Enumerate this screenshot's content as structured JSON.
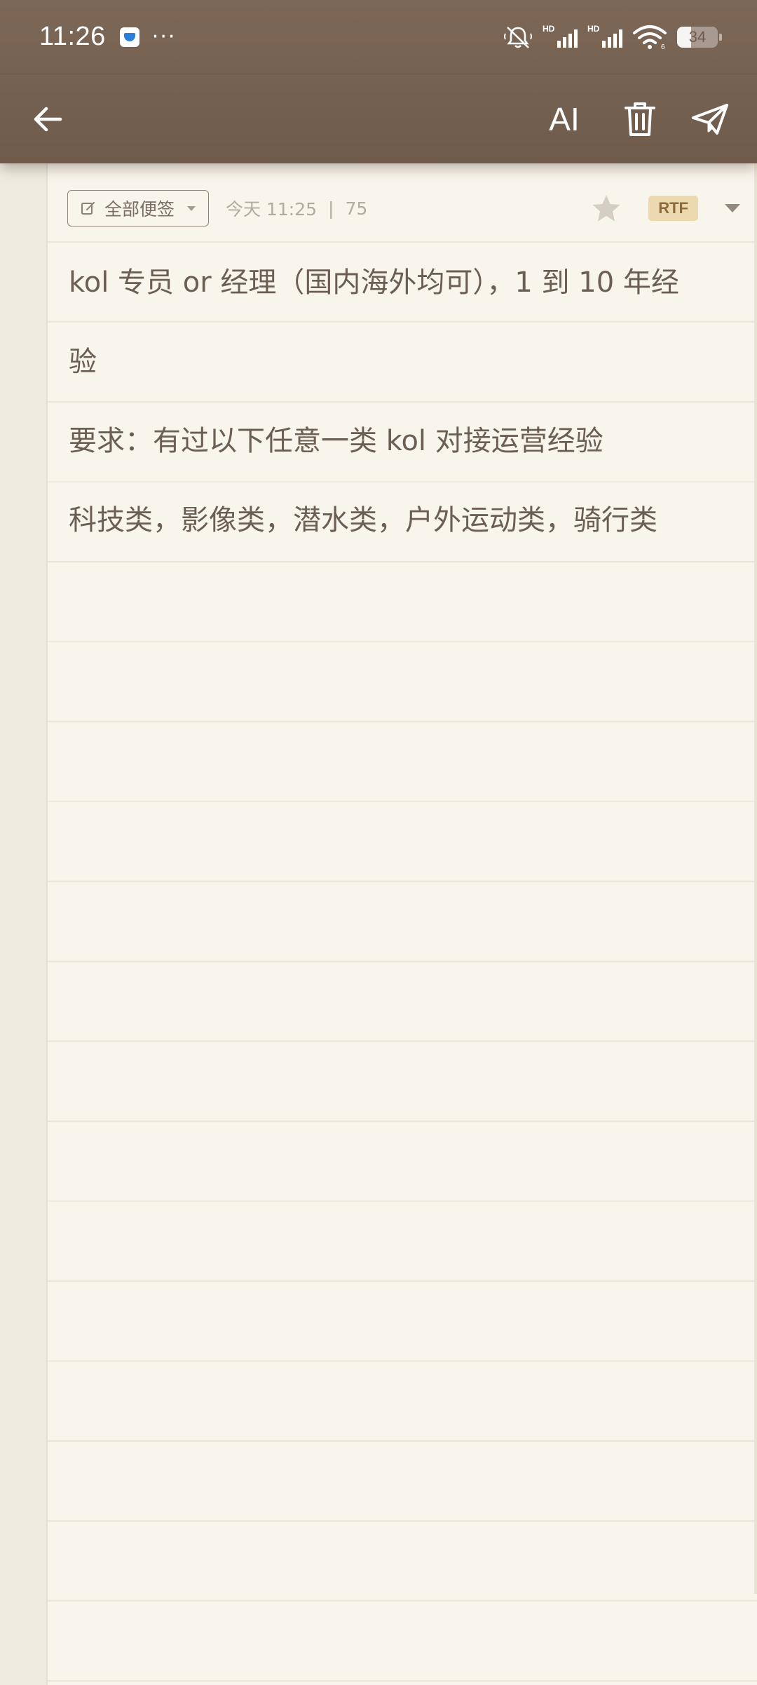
{
  "status_bar": {
    "time": "11:26",
    "dots": "···",
    "battery_level": "34",
    "hd_label": "HD"
  },
  "toolbar": {
    "ai_label": "AI"
  },
  "note_meta": {
    "folder_label": "全部便签",
    "date": "今天 11:25",
    "separator": "|",
    "char_count": "75",
    "format_badge": "RTF"
  },
  "note_lines": [
    "kol 专员 or 经理（国内海外均可），1 到 10 年经",
    "验",
    "要求：有过以下任意一类 kol 对接运营经验",
    "科技类，影像类，潜水类，户外运动类，骑行类"
  ],
  "colors": {
    "header_brown": "#75614f",
    "paper": "#f8f5ec",
    "text": "#6b5e52",
    "rtf_badge_bg": "#ecd9b0"
  }
}
